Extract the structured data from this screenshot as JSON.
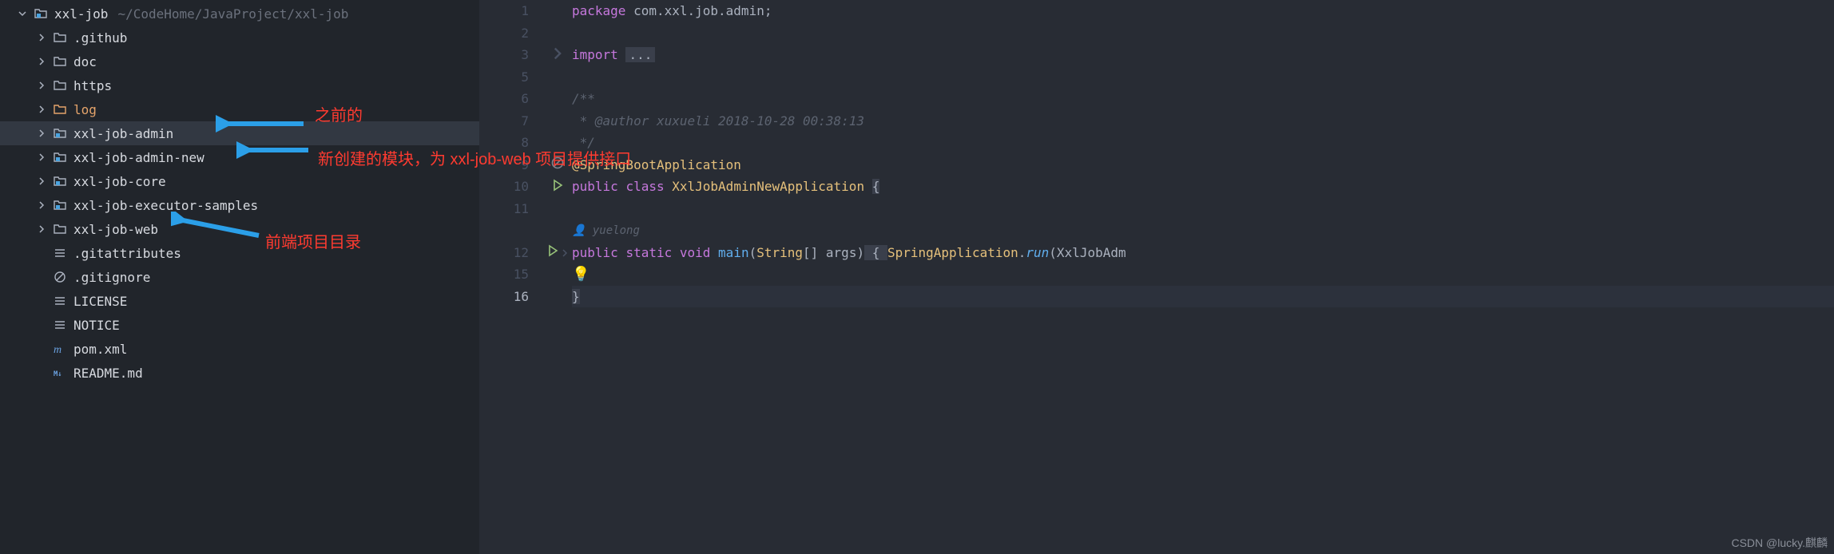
{
  "project": {
    "root": {
      "name": "xxl-job",
      "path": "~/CodeHome/JavaProject/xxl-job"
    },
    "children": [
      {
        "name": ".github",
        "type": "folder"
      },
      {
        "name": "doc",
        "type": "folder"
      },
      {
        "name": "https",
        "type": "folder"
      },
      {
        "name": "log",
        "type": "folder",
        "color": "orange"
      },
      {
        "name": "xxl-job-admin",
        "type": "module",
        "selected": true
      },
      {
        "name": "xxl-job-admin-new",
        "type": "module"
      },
      {
        "name": "xxl-job-core",
        "type": "module"
      },
      {
        "name": "xxl-job-executor-samples",
        "type": "module"
      },
      {
        "name": "xxl-job-web",
        "type": "folder"
      },
      {
        "name": ".gitattributes",
        "type": "file-lines"
      },
      {
        "name": ".gitignore",
        "type": "file-ignore"
      },
      {
        "name": "LICENSE",
        "type": "file-lines"
      },
      {
        "name": "NOTICE",
        "type": "file-lines"
      },
      {
        "name": "pom.xml",
        "type": "file-maven"
      },
      {
        "name": "README.md",
        "type": "file-md"
      }
    ]
  },
  "annotations": {
    "a1": "之前的",
    "a2": "新创建的模块，为 xxl-job-web 项目提供接口",
    "a3": "前端项目目录",
    "watermark": "CSDN @lucky.麒麟"
  },
  "editor": {
    "line_numbers": [
      "1",
      "2",
      "3",
      "5",
      "6",
      "7",
      "8",
      "9",
      "10",
      "11",
      "",
      "12",
      "15",
      "16"
    ],
    "code": {
      "l1_pkg": "package",
      "l1_rest": " com.xxl.job.admin;",
      "l3_imp": "import",
      "l3_fold": "...",
      "l6_c": "/**",
      "l7_c": " * @author xuxueli 2018-10-28 00:38:13",
      "l8_c": " */",
      "l9_ann": "@SpringBootApplication",
      "l10_pub": "public",
      "l10_cls": "class",
      "l10_name": "XxlJobAdminNewApplication",
      "l10_br": "{",
      "l11b_author": "yuelong",
      "l12_pub": "public",
      "l12_static": "static",
      "l12_void": "void",
      "l12_main": "main",
      "l12_sig_a": "(",
      "l12_sig_b": "String",
      "l12_sig_c": "[] args)",
      "l12_body_a": " { ",
      "l12_body_b": "SpringApplication",
      "l12_body_c": ".",
      "l12_body_d": "run",
      "l12_body_e": "(XxlJobAdm",
      "l16_close": "}"
    }
  }
}
